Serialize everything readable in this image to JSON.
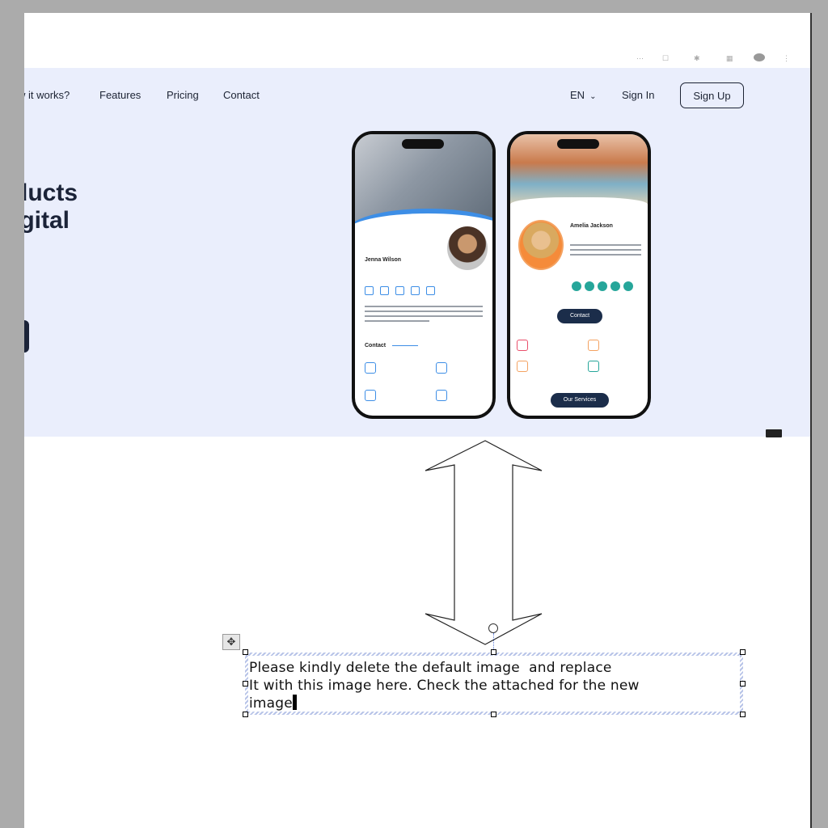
{
  "nav": {
    "links": [
      "w it works?",
      "Features",
      "Pricing",
      "Contact"
    ],
    "language": "EN",
    "sign_in": "Sign In",
    "sign_up": "Sign Up"
  },
  "hero": {
    "headline": "ducts\nigital"
  },
  "phone1": {
    "name": "Jenna Wilson",
    "contact_label": "Contact"
  },
  "phone2": {
    "name": "Amelia Jackson",
    "contact_button": "Contact",
    "services_button": "Our Services"
  },
  "textbox": {
    "line1": "Please kindly delete the default image  and replace",
    "line2": "It with this image here. Check the attached for the new",
    "line3": "image"
  },
  "icons": [
    "move-icon",
    "chevron-down-icon",
    "double-arrow-shape",
    "rotate-handle"
  ]
}
